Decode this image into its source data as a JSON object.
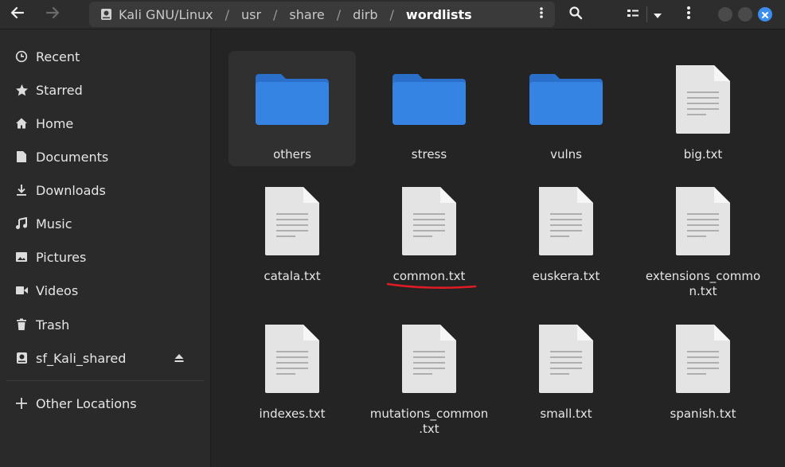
{
  "header": {
    "path": [
      {
        "label": "Kali GNU/Linux"
      },
      {
        "label": "usr"
      },
      {
        "label": "share"
      },
      {
        "label": "dirb"
      },
      {
        "label": "wordlists"
      }
    ]
  },
  "sidebar": {
    "items": [
      {
        "label": "Recent",
        "icon": "clock-icon"
      },
      {
        "label": "Starred",
        "icon": "star-icon"
      },
      {
        "label": "Home",
        "icon": "home-icon"
      },
      {
        "label": "Documents",
        "icon": "document-icon"
      },
      {
        "label": "Downloads",
        "icon": "download-icon"
      },
      {
        "label": "Music",
        "icon": "music-icon"
      },
      {
        "label": "Pictures",
        "icon": "picture-icon"
      },
      {
        "label": "Videos",
        "icon": "video-icon"
      },
      {
        "label": "Trash",
        "icon": "trash-icon"
      },
      {
        "label": "sf_Kali_shared",
        "icon": "drive-icon"
      }
    ],
    "other_locations": "Other Locations"
  },
  "files": [
    {
      "name": "others",
      "type": "folder",
      "selected": true
    },
    {
      "name": "stress",
      "type": "folder"
    },
    {
      "name": "vulns",
      "type": "folder"
    },
    {
      "name": "big.txt",
      "type": "text"
    },
    {
      "name": "catala.txt",
      "type": "text"
    },
    {
      "name": "common.txt",
      "type": "text",
      "annotated": true
    },
    {
      "name": "euskera.txt",
      "type": "text"
    },
    {
      "name": "extensions_common.txt",
      "line1": "extensions_commo",
      "line2": "n.txt",
      "type": "text"
    },
    {
      "name": "indexes.txt",
      "type": "text"
    },
    {
      "name": "mutations_common.txt",
      "line1": "mutations_common",
      "line2": ".txt",
      "type": "text"
    },
    {
      "name": "small.txt",
      "type": "text"
    },
    {
      "name": "spanish.txt",
      "type": "text"
    }
  ],
  "colors": {
    "folder": "#3584e4",
    "accent": "#3b8ef0",
    "annotation": "#e01b24"
  }
}
